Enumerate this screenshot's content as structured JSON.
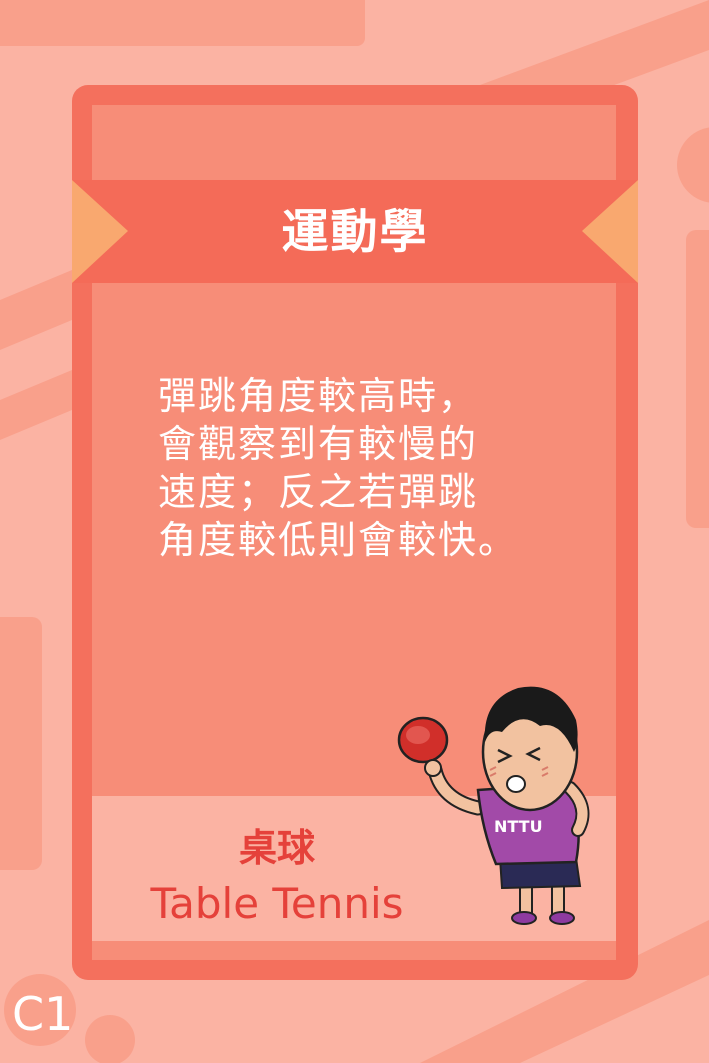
{
  "card": {
    "category": "運動學",
    "body_lines": [
      "彈跳角度較高時，",
      "會觀察到有較慢的",
      "速度；反之若彈跳",
      "角度較低則會較快。"
    ],
    "sport_zh": "桌球",
    "sport_en": "Table Tennis",
    "mascot_shirt_text": "NTTU",
    "card_code": "C1"
  },
  "colors": {
    "background": "#fbb3a3",
    "card_frame": "#f4705d",
    "card_fill": "#f78d78",
    "ribbon": "#f46b58",
    "notch": "#f9a86f",
    "accent_text": "#e5413a",
    "mascot_shirt": "#a24aa8"
  }
}
